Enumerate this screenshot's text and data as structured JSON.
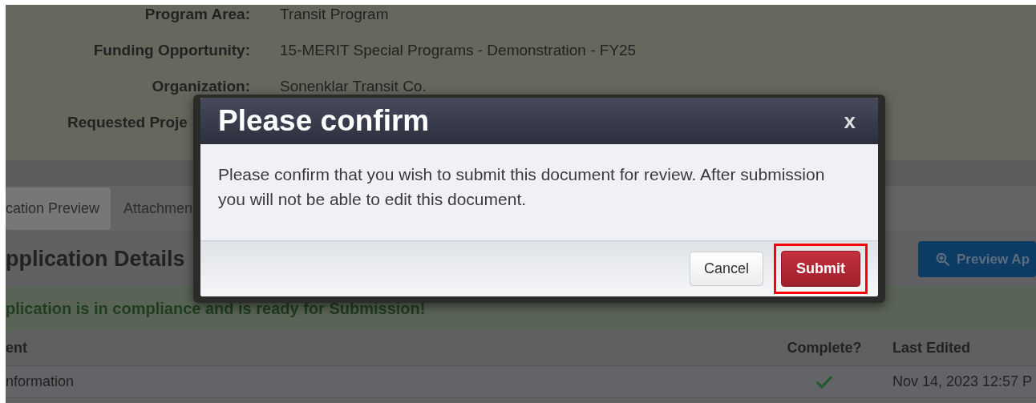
{
  "summary": [
    {
      "label": "Program Area:",
      "value": "Transit Program"
    },
    {
      "label": "Funding Opportunity:",
      "value": "15-MERIT Special Programs - Demonstration - FY25"
    },
    {
      "label": "Organization:",
      "value": "Sonenklar Transit Co."
    },
    {
      "label": "Requested Proje"
    }
  ],
  "tabs": [
    {
      "label": "cation Preview",
      "selected": true
    },
    {
      "label": "Attachmen",
      "selected": false
    }
  ],
  "section_title": "pplication Details",
  "preview_button": "Preview Ap",
  "compliance_message": "plication is in compliance and is ready for Submission!",
  "table": {
    "columns": [
      "ent",
      "Complete?",
      "Last Edited"
    ],
    "rows": [
      {
        "document": "nformation",
        "complete": true,
        "last_edited": "Nov 14, 2023 12:57 P"
      }
    ]
  },
  "dialog": {
    "title": "Please confirm",
    "close": "x",
    "message": "Please confirm that you wish to submit this document for review. After submission you will not be able to edit this document.",
    "buttons": [
      {
        "label": "Cancel",
        "kind": "secondary",
        "highlighted": false
      },
      {
        "label": "Submit",
        "kind": "primary",
        "highlighted": true
      }
    ]
  }
}
